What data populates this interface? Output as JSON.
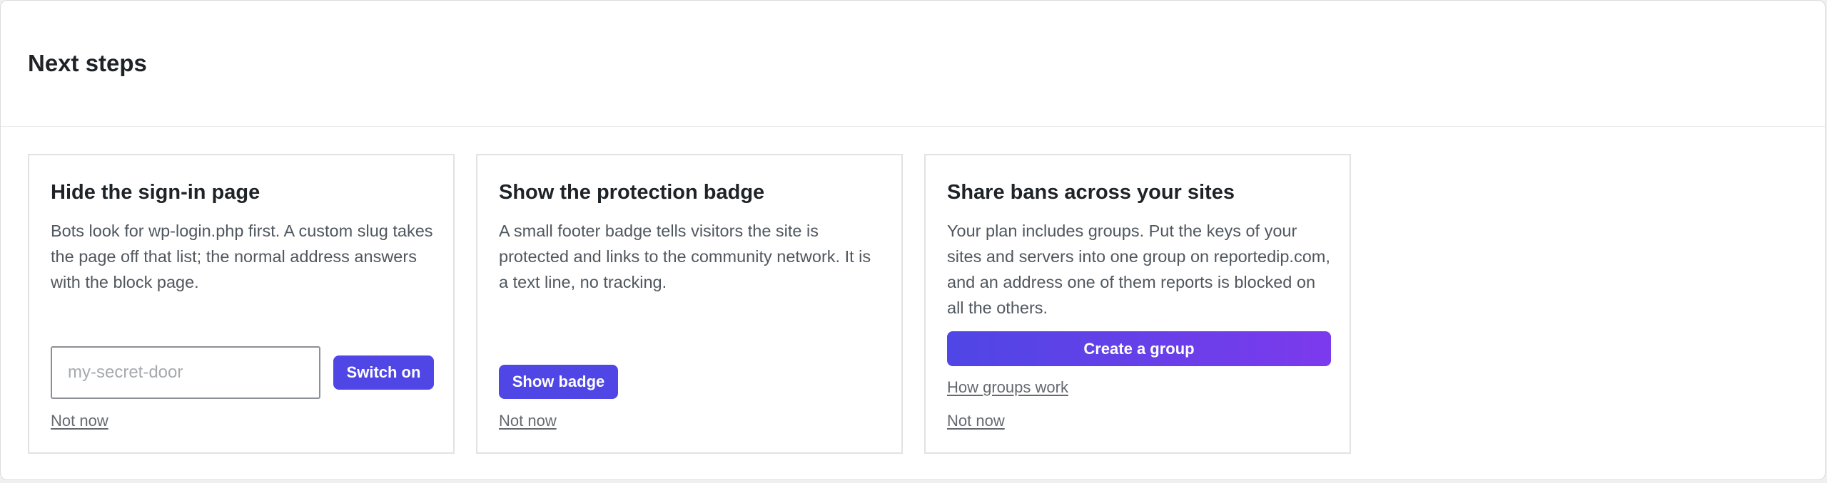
{
  "panel": {
    "title": "Next steps"
  },
  "cards": [
    {
      "title": "Hide the sign-in page",
      "text": "Bots look for wp-login.php first. A custom slug takes the page off that list; the normal address answers with the block page.",
      "input_placeholder": "my-secret-door",
      "input_value": "",
      "button_label": "Switch on",
      "dismiss_label": "Not now"
    },
    {
      "title": "Show the protection badge",
      "text": "A small footer badge tells visitors the site is protected and links to the community network. It is a text line, no tracking.",
      "button_label": "Show badge",
      "dismiss_label": "Not now"
    },
    {
      "title": "Share bans across your sites",
      "text": "Your plan includes groups. Put the keys of your sites and servers into one group on reportedip.com, and an address one of them reports is blocked on all the others.",
      "button_label": "Create a group",
      "link_label": "How groups work",
      "dismiss_label": "Not now"
    }
  ],
  "colors": {
    "accent": "#4f46e5",
    "accent_gradient_end": "#7c3aed",
    "text": "#1d2327",
    "muted_text": "#50575e",
    "link": "#646970",
    "border": "#e2e2e5"
  }
}
